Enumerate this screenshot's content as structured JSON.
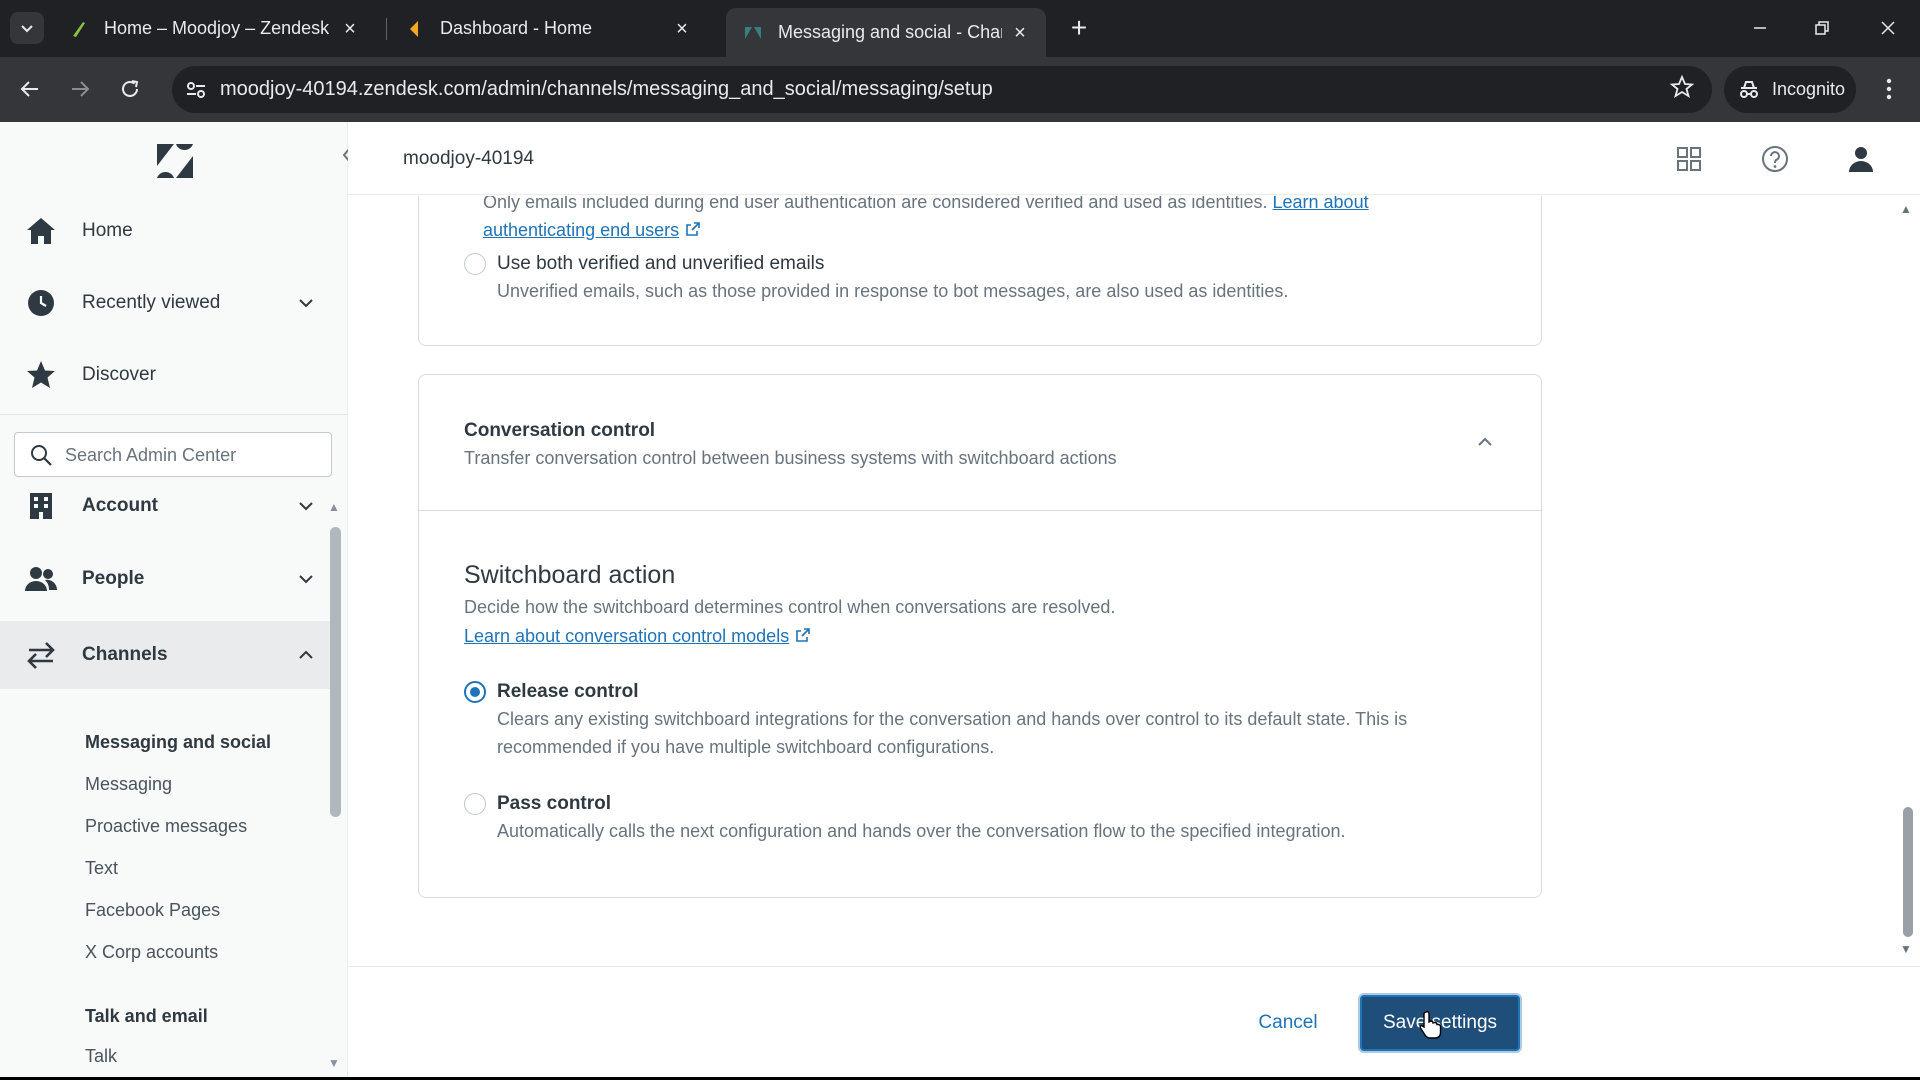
{
  "browser": {
    "tabs": [
      {
        "title": "Home – Moodjoy – Zendesk",
        "active": false
      },
      {
        "title": "Dashboard - Home",
        "active": false
      },
      {
        "title": "Messaging and social - Channe",
        "active": true
      }
    ],
    "url": "moodjoy-40194.zendesk.com/admin/channels/messaging_and_social/messaging/setup",
    "incognito_label": "Incognito"
  },
  "topbar": {
    "account_name": "moodjoy-40194"
  },
  "sidebar": {
    "primary": [
      {
        "label": "Home",
        "icon": "home-icon"
      },
      {
        "label": "Recently viewed",
        "icon": "clock-icon"
      },
      {
        "label": "Discover",
        "icon": "star-icon"
      }
    ],
    "search_placeholder": "Search Admin Center",
    "sections": [
      {
        "label": "Account",
        "icon": "building-icon"
      },
      {
        "label": "People",
        "icon": "people-icon"
      },
      {
        "label": "Channels",
        "icon": "channels-icon"
      }
    ],
    "channels_subnav": {
      "group1_title": "Messaging and social",
      "group1_items": [
        "Messaging",
        "Proactive messages",
        "Text",
        "Facebook Pages",
        "X Corp accounts"
      ],
      "group2_title": "Talk and email",
      "group2_items": [
        "Talk"
      ]
    }
  },
  "identity_card": {
    "verified_desc": "Only emails included during end user authentication are considered verified and used as identities.",
    "verified_link": "Learn about authenticating end users",
    "both_label": "Use both verified and unverified emails",
    "both_desc": "Unverified emails, such as those provided in response to bot messages, are also used as identities."
  },
  "conversation_control": {
    "title": "Conversation control",
    "subtitle": "Transfer conversation control between business systems with switchboard actions",
    "section_title": "Switchboard action",
    "section_desc": "Decide how the switchboard determines control when conversations are resolved.",
    "section_link": "Learn about conversation control models",
    "options": [
      {
        "label": "Release control",
        "desc_line1": "Clears any existing switchboard integrations for the conversation and hands over control to its default state. This is",
        "desc_line2": "recommended if you have multiple switchboard configurations.",
        "selected": true
      },
      {
        "label": "Pass control",
        "desc_line1": "Automatically calls the next configuration and hands over the conversation flow to the specified integration.",
        "selected": false
      }
    ]
  },
  "footer": {
    "cancel_label": "Cancel",
    "save_label": "Save settings"
  },
  "colors": {
    "accent": "#1f73b7",
    "save_button_bg": "#1f4e7a"
  }
}
